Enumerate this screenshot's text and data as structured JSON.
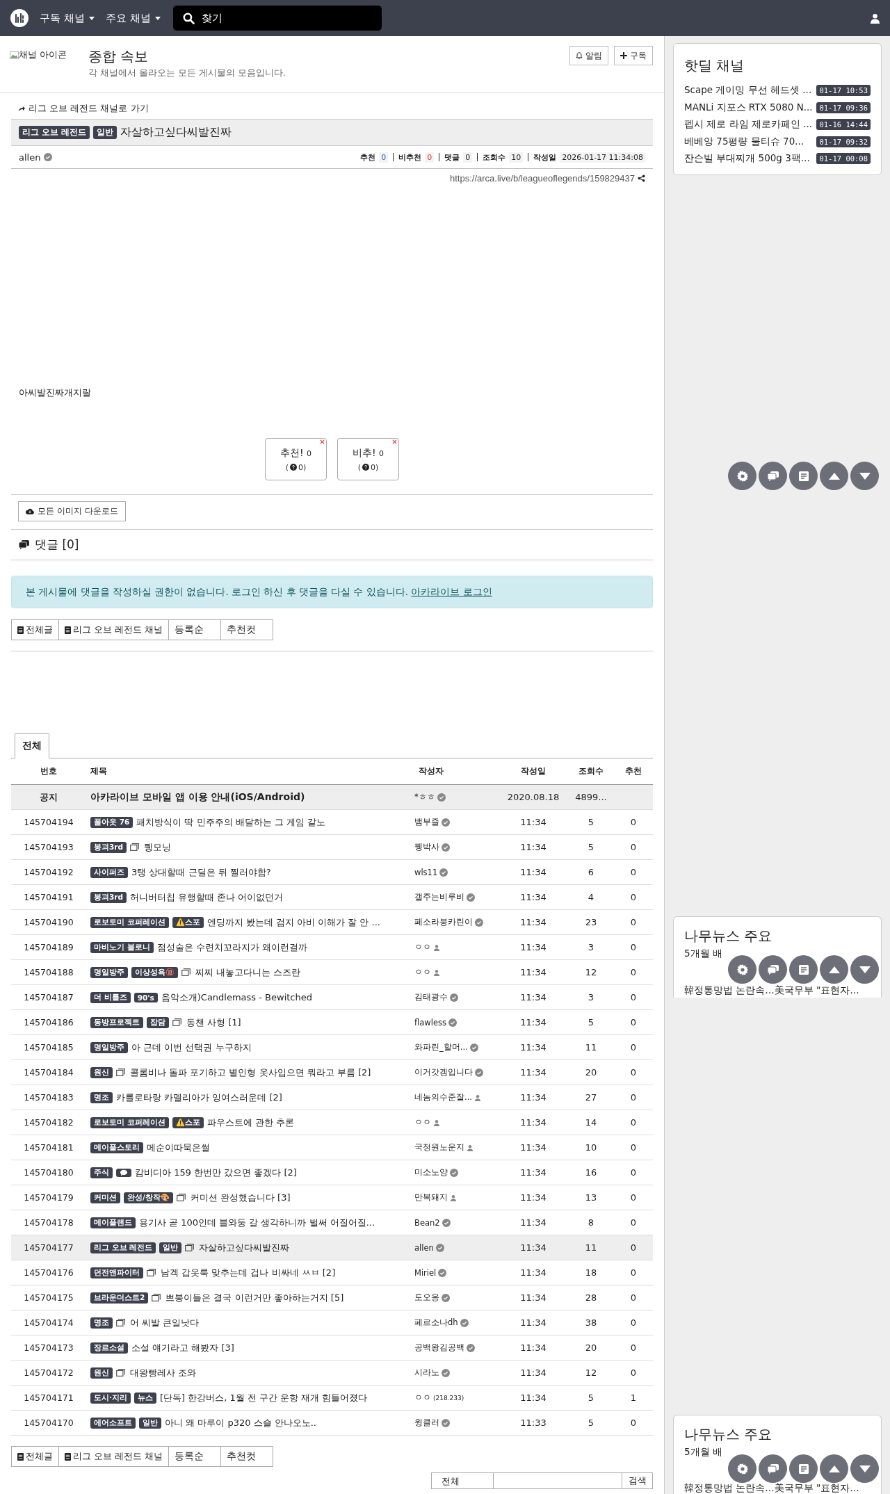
{
  "nav": {
    "menus": [
      "구독 채널",
      "주요 채널"
    ],
    "search": {
      "placeholder": "찾기"
    }
  },
  "channel": {
    "icon_alt": "채널 아이콘",
    "title": "종합 속보",
    "description": "각 채널에서 올라오는 모든 게시물의 모음입니다.",
    "buttons": [
      {
        "label": "알림",
        "kind": "bell"
      },
      {
        "label": "구독",
        "kind": "plus"
      }
    ]
  },
  "article": {
    "back_link": "리그 오브 레전드 채널로 가기",
    "badges": [
      "리그 오브 레전드",
      "일반"
    ],
    "title": "자살하고싶다씨발진짜",
    "author": "allen",
    "stats": [
      {
        "label": "추천",
        "value": "0",
        "kind": "up"
      },
      {
        "label": "비추천",
        "value": "0",
        "kind": "down"
      },
      {
        "label": "댓글",
        "value": "0",
        "kind": "plain"
      },
      {
        "label": "조회수",
        "value": "10",
        "kind": "plain"
      },
      {
        "label": "작성일",
        "value": "2026-01-17 11:34:08",
        "kind": "plain"
      }
    ],
    "url": "https://arca.live/b/leagueoflegends/159829437",
    "body": "아씨발진짜개지랄",
    "votes": [
      {
        "label": "추천!",
        "count": "0",
        "sub": [
          "(",
          "0)"
        ]
      },
      {
        "label": "비추!",
        "count": "0",
        "sub": [
          "(",
          "0)"
        ]
      }
    ],
    "download_button": "모든 이미지 다운로드"
  },
  "comments": {
    "heading": "댓글 [0]",
    "notice": "본 게시물에 댓글을 작성하실 권한이 없습니다. 로그인 하신 후 댓글을 다실 수 있습니다.",
    "login_link": "아카라이브 로그인"
  },
  "filter_tabs_top": [
    {
      "label": "전체글",
      "kind": "board"
    },
    {
      "label": "리그 오브 레전드 채널",
      "kind": "board"
    },
    {
      "label": "등록순",
      "kind": "sort"
    },
    {
      "label": "추천컷",
      "kind": "sort"
    }
  ],
  "board": {
    "tabs": [
      {
        "label": "전체",
        "selected": true
      }
    ],
    "columns": [
      "번호",
      "제목",
      "작성자",
      "작성일",
      "조회수",
      "추천"
    ],
    "notice": {
      "number": "공지",
      "title": "아카라이브 모바일 앱 이용 안내(iOS/Android)",
      "author": {
        "name": "*ㅎㅎ",
        "kind": "verified"
      },
      "date": "2020.08.18",
      "views": "4899..."
    },
    "rows": [
      {
        "number": "145704194",
        "badges": [
          "폴아웃 76"
        ],
        "title": "패치방식이 딱 민주주의 배달하는 그 게임 같노",
        "author": {
          "name": "뱀부즐",
          "kind": "verified"
        },
        "time": "11:34",
        "views": "5",
        "likes": "0",
        "selected": false
      },
      {
        "number": "145704193",
        "badges": [
          "붕괴3rd"
        ],
        "media": {
          "kind": "image"
        },
        "title": "뮁모닝",
        "author": {
          "name": "뮁박사",
          "kind": "verified"
        },
        "time": "11:34",
        "views": "5",
        "likes": "0",
        "selected": false
      },
      {
        "number": "145704192",
        "badges": [
          "사이퍼즈"
        ],
        "title": "3탱 상대할때 근딜은 뒤 찔러야함?",
        "author": {
          "name": "wls11",
          "kind": "verified"
        },
        "time": "11:34",
        "views": "6",
        "likes": "0",
        "selected": false
      },
      {
        "number": "145704191",
        "badges": [
          "붕괴3rd"
        ],
        "title": "허니버터칩 유행할때 존나 어이없던거",
        "author": {
          "name": "갤주는비루비",
          "kind": "verified"
        },
        "time": "11:34",
        "views": "4",
        "likes": "0",
        "selected": false
      },
      {
        "number": "145704190",
        "badges": [
          "로보토미 코퍼레이션",
          "⚠️스포"
        ],
        "title": "엔딩까지 봤는데 검지 아비 이해가 잘 안 ...",
        "author": {
          "name": "페소라붕카린이",
          "kind": "verified"
        },
        "time": "11:34",
        "views": "23",
        "likes": "0",
        "selected": false
      },
      {
        "number": "145704189",
        "badges": [
          "마비노기 블로니"
        ],
        "title": "점성술은 수련치꼬라지가 왜이런걸까",
        "author": {
          "name": "ㅇㅇ",
          "kind": "member"
        },
        "time": "11:34",
        "views": "3",
        "likes": "0",
        "selected": false
      },
      {
        "number": "145704188",
        "badges": [
          "명일방주",
          "이상성욕🔞"
        ],
        "media": {
          "kind": "image"
        },
        "title": "찌찌 내놓고다니는 스즈란",
        "author": {
          "name": "ㅇㅇ",
          "kind": "member"
        },
        "time": "11:34",
        "views": "12",
        "likes": "0",
        "selected": false
      },
      {
        "number": "145704187",
        "badges": [
          "더 비틀즈",
          "90's"
        ],
        "title": "음악소개)Candlemass - Bewitched",
        "author": {
          "name": "김태광수",
          "kind": "verified"
        },
        "time": "11:34",
        "views": "3",
        "likes": "0",
        "selected": false
      },
      {
        "number": "145704186",
        "badges": [
          "동방프로젝트",
          "잡담"
        ],
        "media": {
          "kind": "image"
        },
        "title": "동챈 사형 [1]",
        "author": {
          "name": "flawless",
          "kind": "verified"
        },
        "time": "11:34",
        "views": "5",
        "likes": "0",
        "selected": false
      },
      {
        "number": "145704185",
        "badges": [
          "명일방주"
        ],
        "title": "아 근데 이번 선택권 누구하지",
        "author": {
          "name": "와파린_할머...",
          "kind": "verified"
        },
        "time": "11:34",
        "views": "11",
        "likes": "0",
        "selected": false
      },
      {
        "number": "145704184",
        "badges": [
          "원신"
        ],
        "media": {
          "kind": "image"
        },
        "title": "콜롬비나 돌파 포기하고 별인형 옷사입으면 뭐라고 부름 [2]",
        "author": {
          "name": "이거갓겜입니다",
          "kind": "verified"
        },
        "time": "11:34",
        "views": "20",
        "likes": "0",
        "selected": false
      },
      {
        "number": "145704183",
        "badges": [
          "명조"
        ],
        "title": "카를로타랑 카멜리아가 잉여스러운데 [2]",
        "author": {
          "name": "네놈의수준잘...",
          "kind": "member"
        },
        "time": "11:34",
        "views": "27",
        "likes": "0",
        "selected": false
      },
      {
        "number": "145704182",
        "badges": [
          "로보토미 코퍼레이션",
          "⚠️스포"
        ],
        "title": "파우스트에 관한 추론",
        "author": {
          "name": "ㅇㅇ",
          "kind": "member"
        },
        "time": "11:34",
        "views": "14",
        "likes": "0",
        "selected": false
      },
      {
        "number": "145704181",
        "badges": [
          "메이플스토리"
        ],
        "title": "메순이따묵은썰",
        "author": {
          "name": "국정원노운지",
          "kind": "member"
        },
        "time": "11:34",
        "views": "10",
        "likes": "0",
        "selected": false
      },
      {
        "number": "145704180",
        "badges": [
          "주식"
        ],
        "media": {
          "kind": "chat"
        },
        "title": "캄비디아 159 한번만 갔으면 좋겠다 [2]",
        "author": {
          "name": "미소노양",
          "kind": "verified"
        },
        "time": "11:34",
        "views": "16",
        "likes": "0",
        "selected": false
      },
      {
        "number": "145704179",
        "badges": [
          "커미션",
          "완성/창작🎨"
        ],
        "media": {
          "kind": "image"
        },
        "title": "커미션 완성했습니다 [3]",
        "author": {
          "name": "만복돼지",
          "kind": "member"
        },
        "time": "11:34",
        "views": "13",
        "likes": "0",
        "selected": false
      },
      {
        "number": "145704178",
        "badges": [
          "메이플랜드"
        ],
        "title": "용기사 곧 100인데 블와둥 갈 생각하니까 벌써 어질어질...",
        "author": {
          "name": "Bean2",
          "kind": "verified"
        },
        "time": "11:34",
        "views": "8",
        "likes": "0",
        "selected": false
      },
      {
        "number": "145704177",
        "badges": [
          "리그 오브 레전드",
          "일반"
        ],
        "media": {
          "kind": "image"
        },
        "title": "자살하고싶다씨발진짜",
        "author": {
          "name": "allen",
          "kind": "verified"
        },
        "time": "11:34",
        "views": "11",
        "likes": "0",
        "selected": true
      },
      {
        "number": "145704176",
        "badges": [
          "던전앤파이터"
        ],
        "media": {
          "kind": "image"
        },
        "title": "남겍 갑옷룩 맞추는데 겁나 비싸네 ㅆㅂ [2]",
        "author": {
          "name": "Miriel",
          "kind": "verified"
        },
        "time": "11:34",
        "views": "18",
        "likes": "0",
        "selected": false
      },
      {
        "number": "145704175",
        "badges": [
          "브라운더스트2"
        ],
        "media": {
          "kind": "image"
        },
        "title": "쁘붕이들은 결국 이런거만 좋아하는거지 [5]",
        "author": {
          "name": "도오옹",
          "kind": "verified"
        },
        "time": "11:34",
        "views": "28",
        "likes": "0",
        "selected": false
      },
      {
        "number": "145704174",
        "badges": [
          "명조"
        ],
        "media": {
          "kind": "image"
        },
        "title": "어 씨발 큰일낫다",
        "author": {
          "name": "페르소나dh",
          "kind": "verified"
        },
        "time": "11:34",
        "views": "38",
        "likes": "0",
        "selected": false
      },
      {
        "number": "145704173",
        "badges": [
          "장르소설"
        ],
        "title": "소설 얘기라고 해봤자 [3]",
        "author": {
          "name": "공백왕김공백",
          "kind": "verified"
        },
        "time": "11:34",
        "views": "20",
        "likes": "0",
        "selected": false
      },
      {
        "number": "145704172",
        "badges": [
          "원신"
        ],
        "media": {
          "kind": "image"
        },
        "title": "대왕빵레사 조와",
        "author": {
          "name": "시라노",
          "kind": "verified"
        },
        "time": "11:34",
        "views": "12",
        "likes": "0",
        "selected": false
      },
      {
        "number": "145704171",
        "badges": [
          "도시·지리",
          "뉴스"
        ],
        "title": "[단독] 한강버스, 1월 전 구간 운항 재개 힘들어졌다",
        "author": {
          "name": "ㅇㅇ",
          "kind": "ip",
          "ip": "(218.233)"
        },
        "time": "11:34",
        "views": "5",
        "likes": "1",
        "selected": false
      },
      {
        "number": "145704170",
        "badges": [
          "에어소프트",
          "일반"
        ],
        "title": "아니 왜 마루이 p320 스슬 안나오노..",
        "author": {
          "name": "윙클러",
          "kind": "verified"
        },
        "time": "11:33",
        "views": "5",
        "likes": "0",
        "selected": false
      }
    ]
  },
  "filter_tabs_bottom": [
    {
      "label": "전체글",
      "kind": "board"
    },
    {
      "label": "리그 오브 레전드 채널",
      "kind": "board"
    },
    {
      "label": "등록순",
      "kind": "sort"
    },
    {
      "label": "추천컷",
      "kind": "sort"
    }
  ],
  "search": {
    "scope": "전체",
    "button": "검색"
  },
  "hot_deals": {
    "title": "핫딜 채널",
    "items": [
      {
        "title": "Scape 게이밍 무선 헤드셋 ...",
        "time": "01-17 10:53"
      },
      {
        "title": "MANLi 지포스 RTX 5080 N...",
        "time": "01-17 09:36"
      },
      {
        "title": "펩시 제로 라임 제로카페인 ...",
        "time": "01-16 14:44"
      },
      {
        "title": "베베앙 75평량 물티슈 70...",
        "time": "01-17 09:32"
      },
      {
        "title": "잔슨빌 부대찌개 500g 3팩...",
        "time": "01-17 00:08"
      }
    ]
  },
  "news_panels": [
    {
      "title": "나무뉴스 주요",
      "items": [
        "5개월 배",
        "韓정통망법 논란속…美국무부 \"표현자…"
      ]
    },
    {
      "title": "나무뉴스 주요",
      "items": [
        "5개월 배",
        "韓정통망법 논란속…美국무부 \"표현자…"
      ]
    }
  ]
}
